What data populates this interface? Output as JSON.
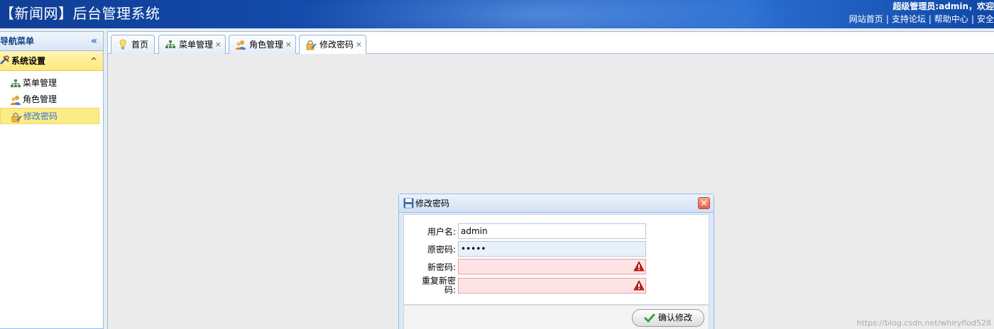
{
  "header": {
    "title": "【新闻网】后台管理系统",
    "user_text": "超级管理员:admin，欢迎",
    "links": [
      "网站首页",
      "支持论坛",
      "帮助中心",
      "安全"
    ],
    "separator": "|"
  },
  "sidebar": {
    "title": "导航菜单",
    "collapse_glyph": "«",
    "section": {
      "label": "系统设置",
      "toggle_glyph": "^"
    },
    "items": [
      {
        "label": "菜单管理",
        "icon": "sitemap-icon"
      },
      {
        "label": "角色管理",
        "icon": "user-group-icon"
      },
      {
        "label": "修改密码",
        "icon": "edit-password-icon",
        "active": true
      }
    ]
  },
  "tabs": [
    {
      "label": "首页",
      "icon": "lightbulb-icon",
      "closable": false
    },
    {
      "label": "菜单管理",
      "icon": "sitemap-icon",
      "closable": true
    },
    {
      "label": "角色管理",
      "icon": "user-group-icon",
      "closable": true
    },
    {
      "label": "修改密码",
      "icon": "edit-password-icon",
      "closable": true,
      "active": true
    }
  ],
  "tab_close_glyph": "×",
  "dialog": {
    "title": "修改密码",
    "close_glyph": "×",
    "fields": {
      "username": {
        "label": "用户名:",
        "value": "admin"
      },
      "old_password": {
        "label": "原密码:",
        "value": "•••••"
      },
      "new_password": {
        "label": "新密码:",
        "value": ""
      },
      "repeat_password": {
        "label_line1": "重复新密",
        "label_line2": "码:",
        "value": ""
      }
    },
    "submit_label": "确认修改"
  },
  "watermark": "https://blog.csdn.net/whiryflod528",
  "colors": {
    "header_blue": "#1650b3",
    "accent_yellow": "#fbec88",
    "error_pink": "#fde3e3",
    "border_blue": "#99bbe8"
  }
}
